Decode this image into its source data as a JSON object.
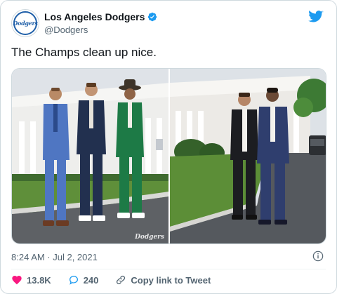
{
  "account": {
    "display_name": "Los Angeles Dodgers",
    "handle": "@Dodgers",
    "avatar_text": "Dodgers",
    "verified_icon": "verified-badge-icon",
    "brand_icon": "twitter-bird-icon"
  },
  "tweet": {
    "text": "The Champs clean up nice.",
    "timestamp": "8:24 AM · Jul 2, 2021"
  },
  "media": {
    "watermark": "Dodgers",
    "photos": [
      {
        "subject": "three players in suits on White House lawn"
      },
      {
        "subject": "two players in suits on White House driveway"
      }
    ]
  },
  "actions": {
    "like_count": "13.8K",
    "reply_count": "240",
    "copy_link_label": "Copy link to Tweet"
  },
  "colors": {
    "twitter_blue": "#1d9bf0",
    "like_red": "#f91880",
    "text_primary": "#0f1419",
    "text_secondary": "#536471",
    "dodger_blue": "#1f5fa8"
  }
}
